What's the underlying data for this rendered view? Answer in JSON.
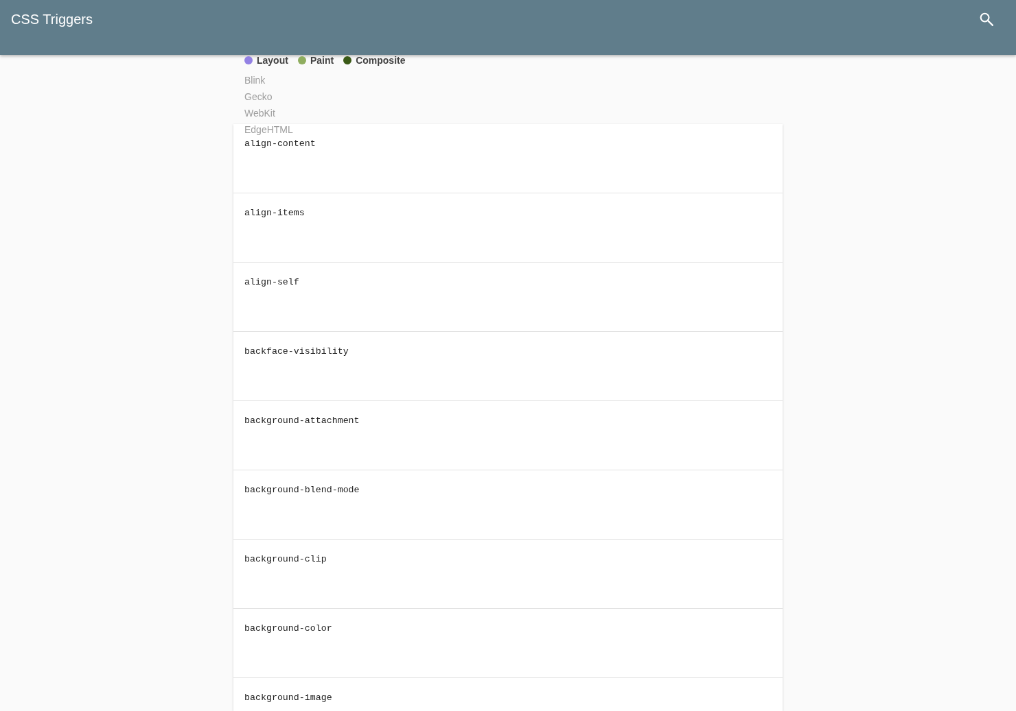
{
  "app_bar": {
    "title": "CSS Triggers"
  },
  "legend": [
    {
      "label": "Layout",
      "color": "#9381e4"
    },
    {
      "label": "Paint",
      "color": "#8fad5f"
    },
    {
      "label": "Composite",
      "color": "#3b5a17"
    }
  ],
  "engines": [
    "Blink",
    "Gecko",
    "WebKit",
    "EdgeHTML"
  ],
  "properties": [
    "align-content",
    "align-items",
    "align-self",
    "backface-visibility",
    "background-attachment",
    "background-blend-mode",
    "background-clip",
    "background-color",
    "background-image"
  ]
}
